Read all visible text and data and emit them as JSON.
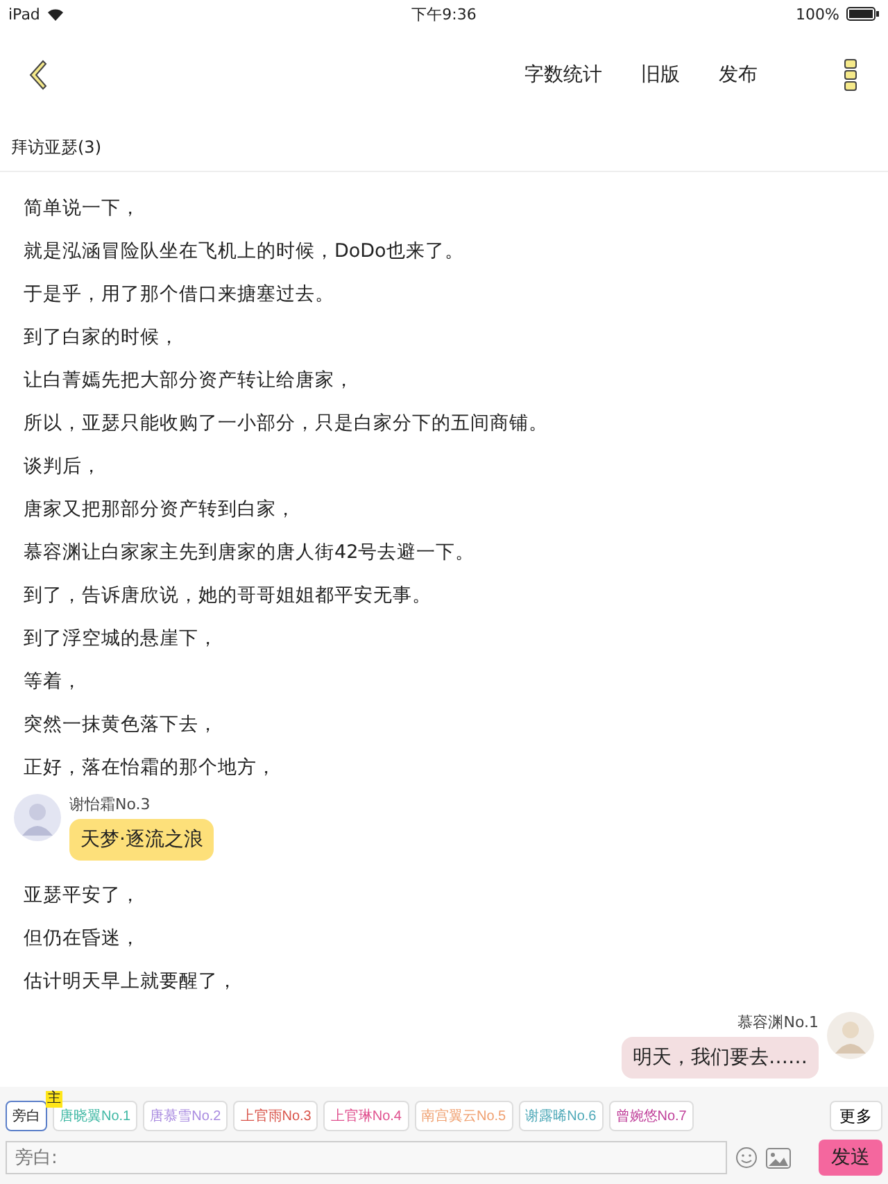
{
  "status_bar": {
    "device": "iPad",
    "time": "下午9:36",
    "battery": "100%"
  },
  "nav": {
    "actions": [
      "字数统计",
      "旧版",
      "发布"
    ]
  },
  "chapter_title": "拜访亚瑟(3)",
  "story": [
    {
      "kind": "text",
      "text": "简单说一下，"
    },
    {
      "kind": "text",
      "text": "就是泓涵冒险队坐在飞机上的时候，DoDo也来了。"
    },
    {
      "kind": "text",
      "text": "于是乎，用了那个借口来搪塞过去。"
    },
    {
      "kind": "text",
      "text": "到了白家的时候，"
    },
    {
      "kind": "text",
      "text": "让白菁嫣先把大部分资产转让给唐家，"
    },
    {
      "kind": "text",
      "text": "所以，亚瑟只能收购了一小部分，只是白家分下的五间商铺。"
    },
    {
      "kind": "text",
      "text": "谈判后，"
    },
    {
      "kind": "text",
      "text": "唐家又把那部分资产转到白家，"
    },
    {
      "kind": "text",
      "text": "慕容渊让白家家主先到唐家的唐人街42号去避一下。"
    },
    {
      "kind": "text",
      "text": "到了，告诉唐欣说，她的哥哥姐姐都平安无事。"
    },
    {
      "kind": "text",
      "text": "到了浮空城的悬崖下，"
    },
    {
      "kind": "text",
      "text": "等着，"
    },
    {
      "kind": "text",
      "text": "突然一抹黄色落下去，"
    },
    {
      "kind": "text",
      "text": "正好，落在怡霜的那个地方，"
    },
    {
      "kind": "left_message",
      "speaker": "谢怡霜No.3",
      "text": "天梦·逐流之浪",
      "color": "#fde07a"
    },
    {
      "kind": "text",
      "text": "亚瑟平安了，"
    },
    {
      "kind": "text",
      "text": "但仍在昏迷，"
    },
    {
      "kind": "text",
      "text": "估计明天早上就要醒了，"
    },
    {
      "kind": "right_message",
      "speaker": "慕容渊No.1",
      "text": "明天，我们要去……",
      "color": "#f3dfe1"
    }
  ],
  "characters": [
    {
      "label": "旁白",
      "selected": true,
      "color": "#222222",
      "main": false
    },
    {
      "label": "唐晓翼No.1",
      "selected": false,
      "color": "#3fb8a4",
      "main": true
    },
    {
      "label": "唐慕雪No.2",
      "selected": false,
      "color": "#a98be0",
      "main": false
    },
    {
      "label": "上官雨No.3",
      "selected": false,
      "color": "#d9544a",
      "main": false
    },
    {
      "label": "上官琳No.4",
      "selected": false,
      "color": "#e0518f",
      "main": false
    },
    {
      "label": "南宫翼云No.5",
      "selected": false,
      "color": "#f0a070",
      "main": false
    },
    {
      "label": "谢露晞No.6",
      "selected": false,
      "color": "#4fa9b8",
      "main": false
    },
    {
      "label": "曾婉悠No.7",
      "selected": false,
      "color": "#c0409a",
      "main": false
    }
  ],
  "main_badge": "主",
  "more_button": "更多",
  "input": {
    "placeholder": "旁白:"
  },
  "send_button": "发送"
}
